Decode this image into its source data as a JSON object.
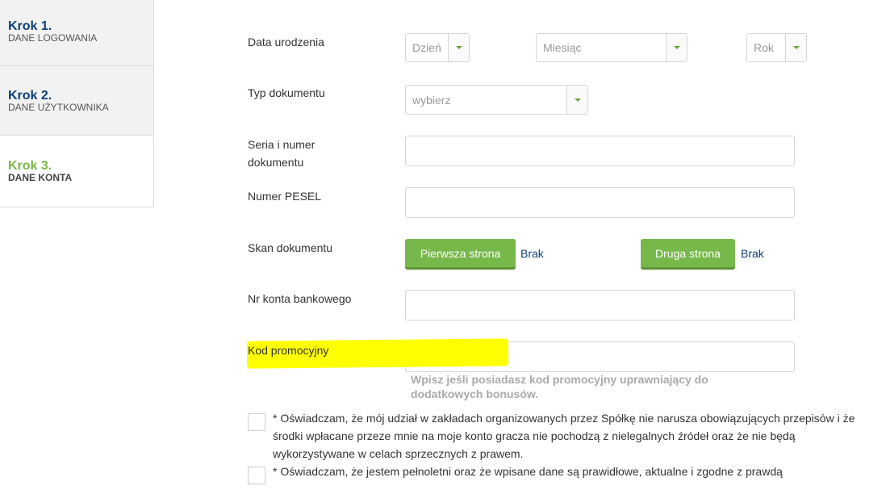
{
  "steps": [
    {
      "title": "Krok 1.",
      "subtitle": "DANE LOGOWANIA"
    },
    {
      "title": "Krok 2.",
      "subtitle": "DANE UŻYTKOWNIKA"
    },
    {
      "title": "Krok 3.",
      "subtitle": "DANE KONTA"
    }
  ],
  "form": {
    "birthdate": {
      "label": "Data urodzenia",
      "day_placeholder": "Dzień",
      "month_placeholder": "Miesiąc",
      "year_placeholder": "Rok"
    },
    "doc_type": {
      "label": "Typ dokumentu",
      "placeholder": "wybierz"
    },
    "doc_number": {
      "label": "Seria i numer dokumentu",
      "value": ""
    },
    "pesel": {
      "label": "Numer PESEL",
      "value": ""
    },
    "scan": {
      "label": "Skan dokumentu",
      "front_button": "Pierwsza strona",
      "front_status": "Brak",
      "back_button": "Druga strona",
      "back_status": "Brak"
    },
    "bank_account": {
      "label": "Nr konta bankowego",
      "value": ""
    },
    "promo": {
      "label": "Kod promocyjny",
      "value": "",
      "hint": "Wpisz jeśli posiadasz kod promocyjny uprawniający do dodatkowych bonusów."
    }
  },
  "consents": [
    {
      "text": "* Oświadczam, że mój udział w zakładach organizowanych przez Spółkę nie narusza obowiązujących przepisów i że środki wpłacane przeze mnie na moje konto gracza nie pochodzą z nielegalnych źródeł oraz że nie będą wykorzystywane w celach sprzecznych z prawem."
    },
    {
      "text": "* Oświadczam, że jestem pełnoletni oraz że wpisane dane są prawidłowe, aktualne i zgodne z prawdą"
    }
  ],
  "colors": {
    "step_done": "#0e3f76",
    "step_active": "#7ab648",
    "button_green": "#77b84a",
    "link_blue": "#0e3f76",
    "highlight": "#ffff00"
  }
}
